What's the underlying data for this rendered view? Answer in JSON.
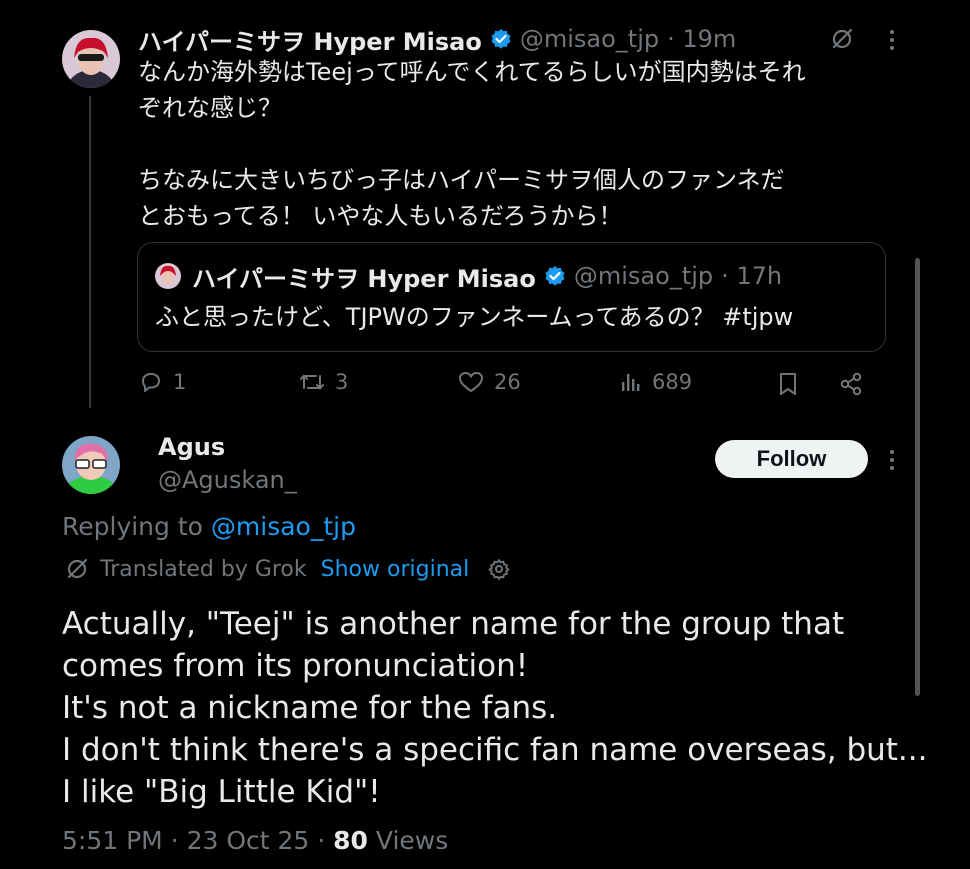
{
  "theme": {
    "bg": "#000000",
    "text": "#e7e9ea",
    "muted": "#71767b",
    "link": "#1d9bf0",
    "verified": "#1d9bf0"
  },
  "parent_tweet": {
    "name": "ハイパーミサヲ Hyper Misao",
    "handle": "@misao_tjp",
    "time": "· 19m",
    "text": "なんか海外勢はTeejって呼んでくれてるらしいが国内勢はそれ\nぞれな感じ？\n\nちなみに大きいちびっ子はハイパーミサヲ個人のファンネだ\nとおもってる！ いやな人もいるだろうから！",
    "quote": {
      "name": "ハイパーミサヲ Hyper Misao",
      "handle": "@misao_tjp",
      "time": "· 17h",
      "text": "ふと思ったけど、TJPWのファンネームってあるの？ #tjpw"
    },
    "stats": {
      "replies": "1",
      "reposts": "3",
      "likes": "26",
      "views": "689"
    }
  },
  "reply_tweet": {
    "name": "Agus",
    "handle": "@Aguskan_",
    "follow_label": "Follow",
    "replying_prefix": "Replying to ",
    "replying_handle": "@misao_tjp",
    "translated_label": "Translated by Grok",
    "show_original_label": "Show original",
    "text_lines": [
      "Actually, \"Teej\" is another name for the group that",
      "comes from its pronunciation!",
      "It's not a nickname for the fans.",
      "I don't think there's a specific fan name overseas, but...",
      "I like \"Big Little Kid\"!"
    ],
    "timestamp": "5:51 PM · 23 Oct 25 · ",
    "views_count": "80",
    "views_label": " Views"
  },
  "icons": [
    "grok-icon",
    "more-icon",
    "verified-icon",
    "reply-icon",
    "repost-icon",
    "like-icon",
    "views-icon",
    "bookmark-icon",
    "share-icon",
    "gear-icon"
  ]
}
